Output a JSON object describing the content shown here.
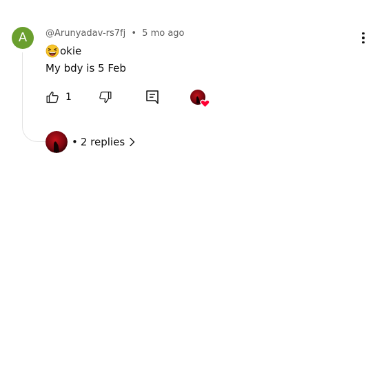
{
  "comment": {
    "avatar_letter": "A",
    "avatar_color": "#6a9f2e",
    "author": "@Arunyadav-rs7fj",
    "separator": "•",
    "time": "5 mo ago",
    "line1_text": "okie",
    "line1_emoji": "grinning-squinting-face-emoji",
    "line2_text": "My bdy is 5 Feb"
  },
  "actions": {
    "like_icon": "thumbs-up-icon",
    "like_count": "1",
    "dislike_icon": "thumbs-down-icon",
    "reply_icon": "comment-reply-icon",
    "creator_heart_icon": "creator-heart-icon",
    "heart_color": "#ff0033",
    "more_icon": "more-vertical-icon"
  },
  "replies": {
    "separator": "•",
    "label": "2 replies",
    "chevron_icon": "chevron-right-icon"
  }
}
